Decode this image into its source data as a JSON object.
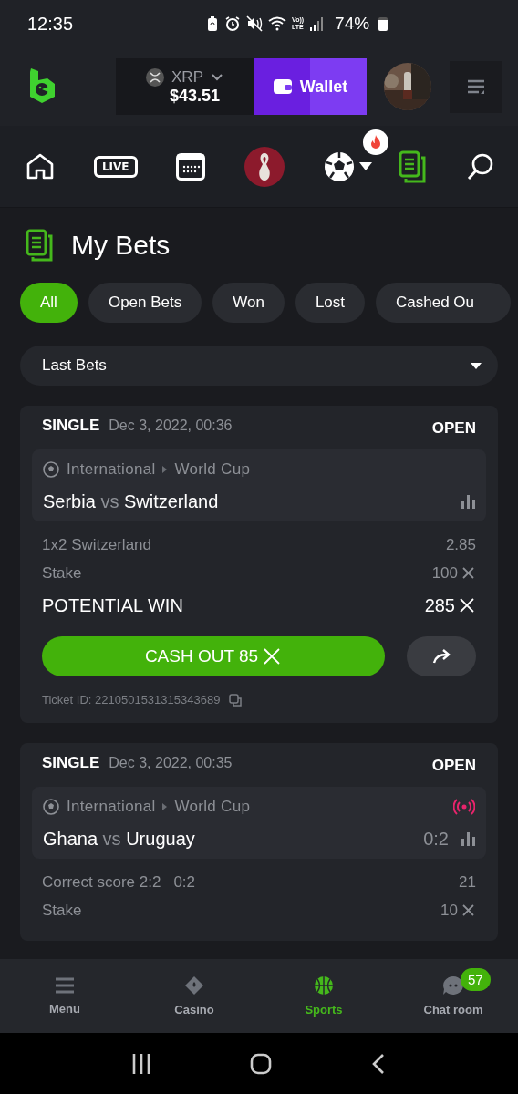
{
  "status_bar": {
    "time": "12:35",
    "icons": [
      {
        "kind": "battery-saver"
      },
      {
        "kind": "alarm"
      },
      {
        "kind": "mute"
      },
      {
        "kind": "wifi"
      },
      {
        "kind": "volte",
        "lines": [
          "Vo))",
          "LTE"
        ]
      },
      {
        "kind": "signal"
      }
    ],
    "battery": "74%"
  },
  "header": {
    "currency": "XRP",
    "balance": "$43.51",
    "wallet_button": "Wallet"
  },
  "nav": [
    {
      "kind": "home",
      "selected": false
    },
    {
      "kind": "live",
      "label": "LIVE",
      "selected": false
    },
    {
      "kind": "calendar",
      "selected": false
    },
    {
      "kind": "trophy",
      "selected": false
    },
    {
      "kind": "soccer",
      "selected": false
    },
    {
      "kind": "dropdown",
      "selected": false
    },
    {
      "kind": "bets",
      "selected": true
    },
    {
      "kind": "search",
      "selected": false
    }
  ],
  "page_title": "My Bets",
  "filters": [
    {
      "label": "All",
      "selected": true
    },
    {
      "label": "Open Bets",
      "selected": false
    },
    {
      "label": "Won",
      "selected": false
    },
    {
      "label": "Lost",
      "selected": false
    },
    {
      "label": "Cashed Ou",
      "selected": false
    }
  ],
  "period_select": "Last Bets",
  "bets": [
    {
      "type": "SINGLE",
      "date": "Dec 3, 2022, 00:36",
      "status": "OPEN",
      "league": "International",
      "tournament": "World Cup",
      "live": false,
      "home": "Serbia",
      "vs": "vs",
      "away": "Switzerland",
      "market": "1x2 Switzerland",
      "odds": "2.85",
      "stake_label": "Stake",
      "stake": "100",
      "potential_label": "POTENTIAL WIN",
      "potential": "285",
      "cashout": "CASH OUT 85",
      "ticket": "Ticket ID: 2210501531315343689"
    },
    {
      "type": "SINGLE",
      "date": "Dec 3, 2022, 00:35",
      "status": "OPEN",
      "league": "International",
      "tournament": "World Cup",
      "live": true,
      "home": "Ghana",
      "vs": "vs",
      "away": "Uruguay",
      "score": "0:2",
      "market": "Correct score 2:2",
      "market_score": "0:2",
      "odds": "21",
      "stake_label": "Stake",
      "stake": "10"
    }
  ],
  "bottom_nav": [
    {
      "kind": "menu",
      "label": "Menu",
      "selected": false
    },
    {
      "kind": "casino",
      "label": "Casino",
      "selected": false
    },
    {
      "kind": "sports",
      "label": "Sports",
      "selected": true
    },
    {
      "kind": "chat",
      "label": "Chat room",
      "selected": false,
      "badge": "57"
    }
  ]
}
